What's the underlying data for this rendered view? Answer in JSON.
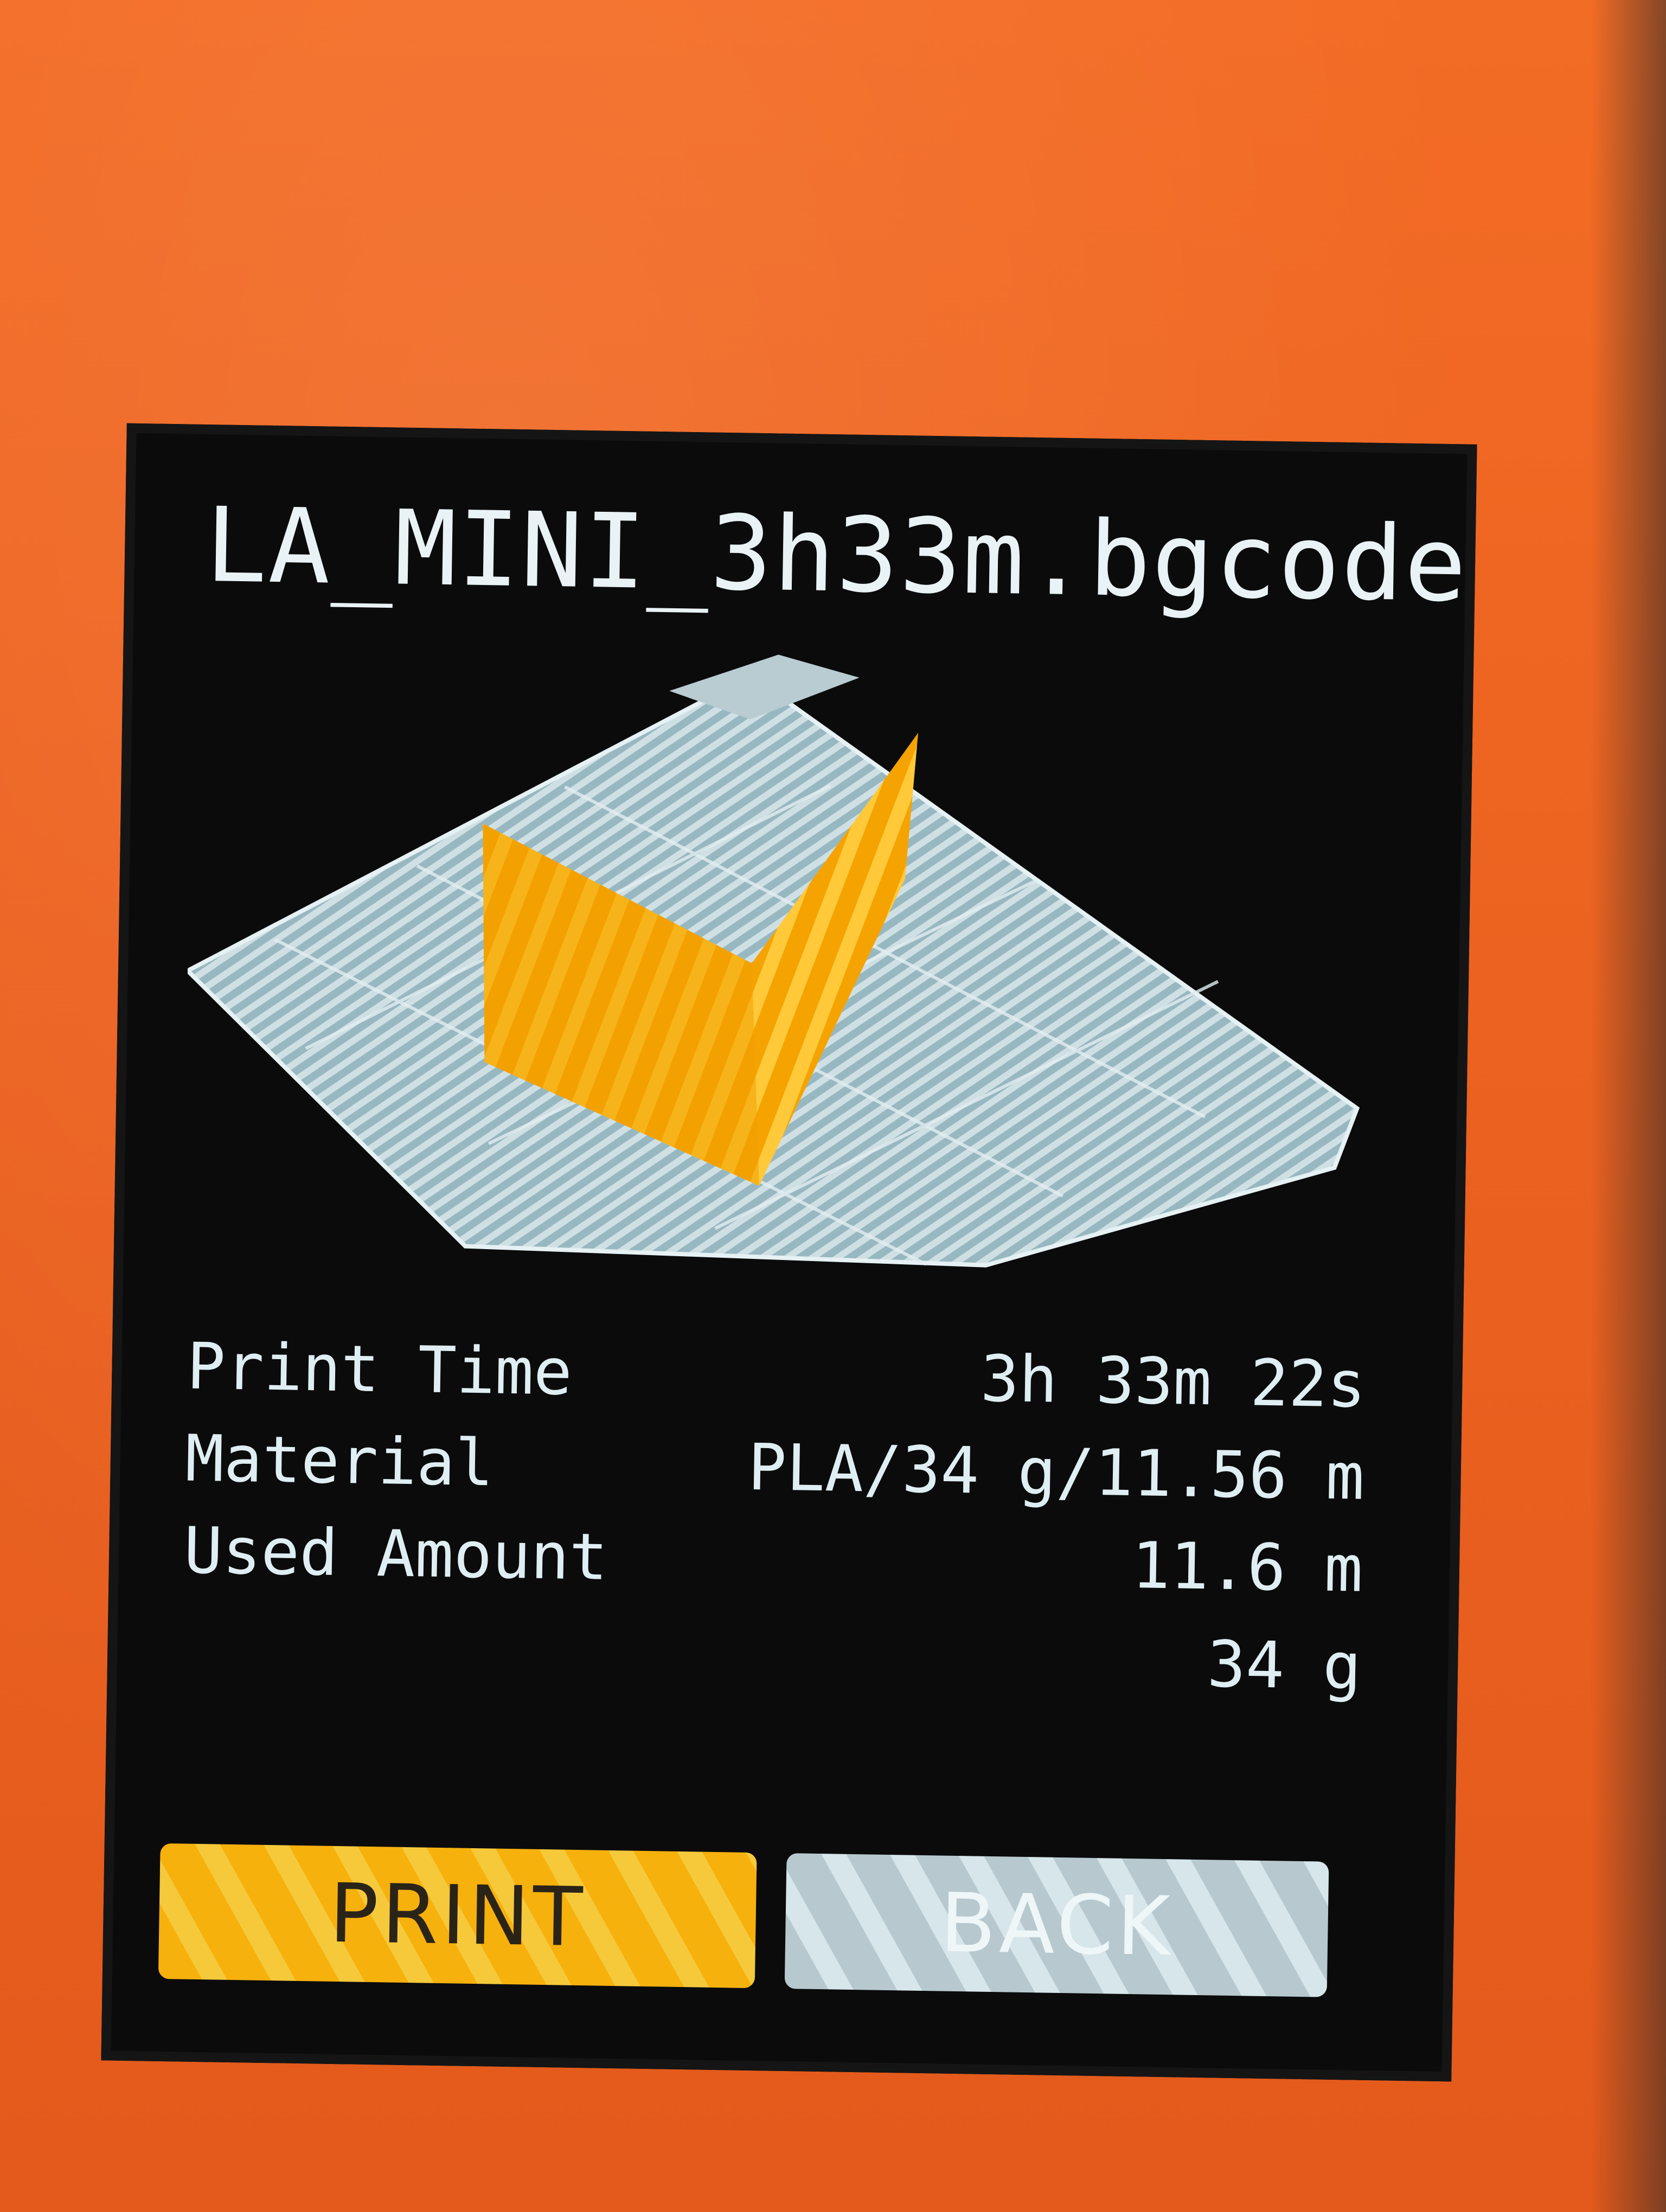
{
  "file": {
    "name": "LA_MINI_3h33m.bgcode"
  },
  "preview": {
    "description_icon": "model-preview-icon",
    "bed_color": "#b6cdd3",
    "model_color": "#f5a300"
  },
  "info": {
    "print_time_label": "Print Time",
    "print_time_value": "3h 33m 22s",
    "material_label": "Material",
    "material_value": "PLA/34 g/11.56 m",
    "used_amount_label": "Used Amount",
    "used_length_value": "11.6 m",
    "used_weight_value": "34 g"
  },
  "buttons": {
    "print_label": "PRINT",
    "back_label": "BACK"
  },
  "colors": {
    "housing": "#f06a23",
    "screen": "#0b0b0c",
    "print_button": "#f7b10d",
    "back_button": "#c7d8dd"
  }
}
